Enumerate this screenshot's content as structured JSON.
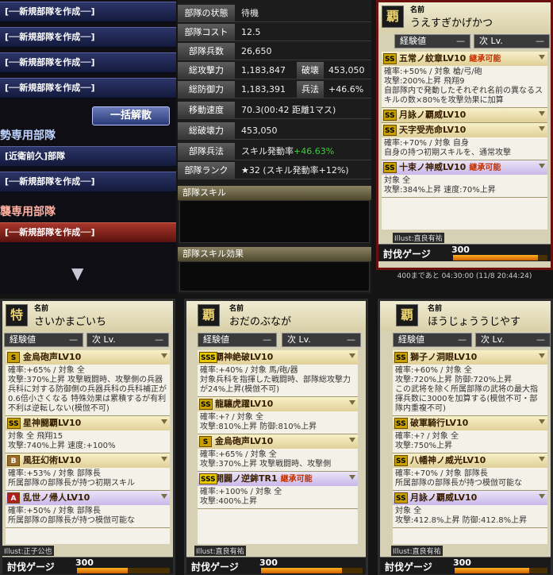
{
  "left": {
    "new_unit": "[──新規部隊を作成──]",
    "disband": "一括解散",
    "section1": "勢専用部隊",
    "section2": "襲専用部隊",
    "named_unit": "[近衛前久]部隊"
  },
  "stats": {
    "status": {
      "label": "部隊の状態",
      "value": "待機"
    },
    "cost": {
      "label": "部隊コスト",
      "value": "12.5"
    },
    "soldiers": {
      "label": "部隊兵数",
      "value": "26,650"
    },
    "attack": {
      "label": "総攻撃力",
      "value": "1,183,847",
      "label2": "破壊",
      "value2": "453,050"
    },
    "defense": {
      "label": "総防御力",
      "value": "1,183,391",
      "label2": "兵法",
      "value2": "+46.6%"
    },
    "speed": {
      "label": "移動速度",
      "value": "70.3(00:42 距離1マス)"
    },
    "destroy": {
      "label": "総破壊力",
      "value": "453,050"
    },
    "tactics": {
      "label": "部隊兵法",
      "value": "スキル発動率",
      "value_green": "+46.63%"
    },
    "rank": {
      "label": "部隊ランク",
      "value": "★32 (スキル発動率+12%)"
    },
    "skill_head": "部隊スキル",
    "effect_head": "部隊スキル効果"
  },
  "cards": [
    {
      "name_label": "名前",
      "name": "うえすぎかげかつ",
      "portrait": "覇",
      "exp_label": "経験値",
      "exp_val": "—",
      "next_label": "次 Lv.",
      "next_val": "—",
      "illust": "Illust:直良有祐",
      "tobatsu": "討伐ゲージ",
      "gauge": "300",
      "gauge_fill": 0.9,
      "skills": [
        {
          "grade": "SS",
          "title": "五常ノ紋章LV10",
          "tag": "継承可能",
          "p": false,
          "body": "確率:+50% / 対象 槍/弓/砲\n攻撃:200%上昇 飛翔9\n自部隊内で発動したそれぞれ名前の異なるスキルの数×80%を攻撃効果に加算"
        },
        {
          "grade": "SS",
          "title": "月詠ノ覇威LV10",
          "tag": "",
          "p": false,
          "body": ""
        },
        {
          "grade": "SS",
          "title": "天字受売命LV10",
          "tag": "",
          "p": false,
          "body": "確率:+70% / 対象 自身\n自身の持つ初期スキルを、通常攻撃"
        },
        {
          "grade": "SS",
          "title": "十束ノ神威LV10",
          "tag": "継承可能",
          "p": true,
          "body": "対象 全\n攻撃:384%上昇 速度:70%上昇"
        }
      ]
    },
    {
      "name_label": "名前",
      "name": "さいかまごいち",
      "portrait": "特",
      "exp_label": "経験値",
      "exp_val": "—",
      "next_label": "次 Lv.",
      "next_val": "—",
      "illust": "Illust:正子公也",
      "tobatsu": "討伐ゲージ",
      "gauge": "300",
      "gauge_fill": 0.55,
      "skills": [
        {
          "grade": "S",
          "title": "金烏砲声LV10",
          "tag": "",
          "p": false,
          "body": "確率:+65% / 対象 全\n攻撃:370%上昇 攻撃戦闘時、攻撃側の兵器兵科に対する防御側の兵器兵科の兵科補正が0.6倍小さくなる 特殊効果は累積するが有利不利は逆転しない(模倣不可)"
        },
        {
          "grade": "SS",
          "title": "星神闘覇LV10",
          "tag": "",
          "p": false,
          "body": "対象 全 飛翔15\n攻撃:740%上昇 速度:+100%"
        },
        {
          "grade": "B",
          "title": "風狂幻術LV10",
          "tag": "",
          "p": false,
          "body": "確率:+53% / 対象 部隊長\n所属部隊の部隊長が持つ初期スキル"
        },
        {
          "grade": "A",
          "title": "乱世ノ帰人LV10",
          "tag": "",
          "p": true,
          "body": "確率:+50% / 対象 部隊長\n所属部隊の部隊長が持つ模倣可能な"
        }
      ]
    },
    {
      "name_label": "名前",
      "name": "おだのぶなが",
      "portrait": "覇",
      "exp_label": "経験値",
      "exp_val": "—",
      "next_label": "次 Lv.",
      "next_val": "—",
      "illust": "Illust:直良有祐",
      "tobatsu": "討伐ゲージ",
      "gauge": "300",
      "gauge_fill": 0.8,
      "skills": [
        {
          "grade": "SSS",
          "title": "覇神絶破LV10",
          "tag": "",
          "p": false,
          "body": "確率:+40% / 対象 馬/砲/器\n対象兵科を指揮した戦闘時、部隊総攻撃力が24%上昇(模倣不可)"
        },
        {
          "grade": "SS",
          "title": "龍驤虎躍LV10",
          "tag": "",
          "p": false,
          "body": "確率:+? / 対象 全\n攻撃:810%上昇 防御:810%上昇"
        },
        {
          "grade": "S",
          "title": "金烏砲声LV10",
          "tag": "",
          "p": false,
          "body": "確率:+65% / 対象 全\n攻撃:370%上昇 攻撃戦闘時、攻撃側"
        },
        {
          "grade": "SSS",
          "title": "開闢ノ逆鉾TR1",
          "tag": "継承可能",
          "p": true,
          "body": "確率:+100% / 対象 全\n攻撃:400%上昇"
        }
      ]
    },
    {
      "name_label": "名前",
      "name": "ほうじょううじやす",
      "portrait": "覇",
      "exp_label": "経験値",
      "exp_val": "—",
      "next_label": "次 Lv.",
      "next_val": "—",
      "illust": "Illust:直良有祐",
      "tobatsu": "討伐ゲージ",
      "gauge": "300",
      "gauge_fill": 0.8,
      "skills": [
        {
          "grade": "SS",
          "title": "獅子ノ洞眼LV10",
          "tag": "",
          "p": false,
          "body": "確率:+60% / 対象 全\n攻撃:720%上昇 防御:720%上昇\nこの武将を除く所属部隊の武将の最大指揮兵数に3000を加算する(模倣不可・部隊内重複不可)"
        },
        {
          "grade": "SS",
          "title": "破軍騎行LV10",
          "tag": "",
          "p": false,
          "body": "確率:+? / 対象 全\n攻撃:750%上昇"
        },
        {
          "grade": "SS",
          "title": "八幡神ノ威光LV10",
          "tag": "",
          "p": false,
          "body": "確率:+70% / 対象 部隊長\n所属部隊の部隊長が持つ模倣可能な"
        },
        {
          "grade": "SS",
          "title": "月詠ノ覇威LV10",
          "tag": "",
          "p": true,
          "body": "対象 全\n攻撃:412.8%上昇 防御:412.8%上昇"
        }
      ]
    }
  ],
  "timestamp": "400まであと 04:30:00 (11/8 20:44:24)"
}
